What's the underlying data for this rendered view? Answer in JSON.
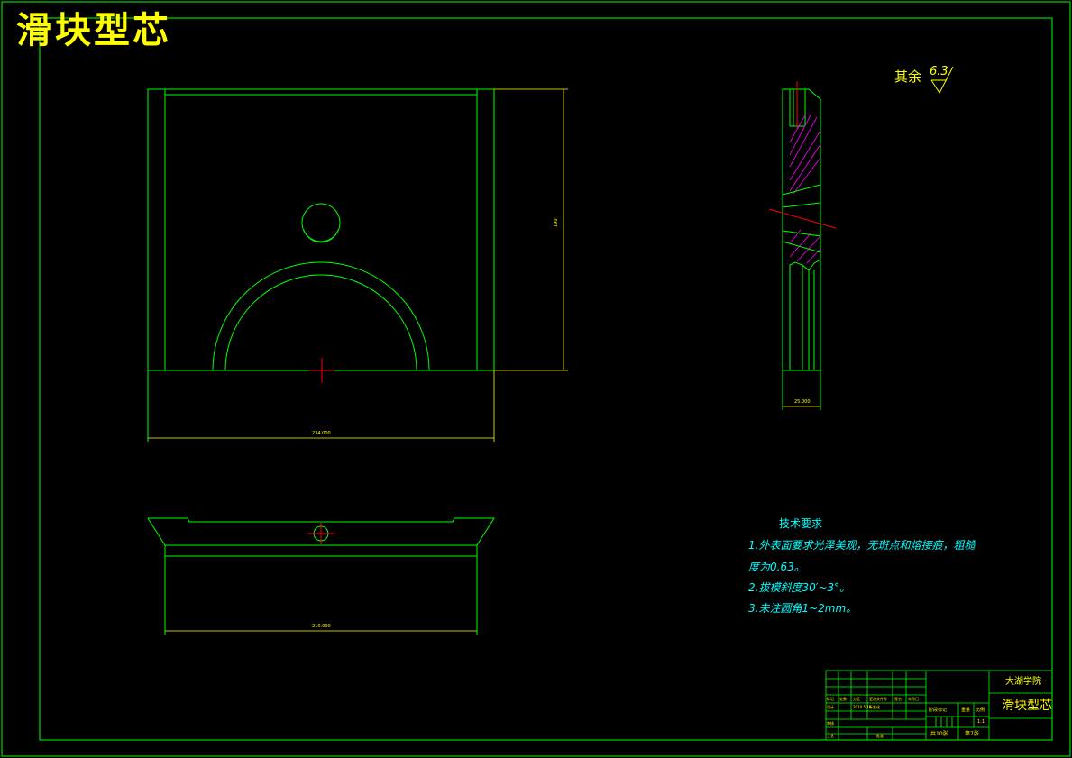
{
  "title": "滑块型芯",
  "roughness": {
    "label": "其余",
    "value": "6.3"
  },
  "tech_requirements": {
    "heading": "技术要求",
    "lines": [
      "1.外表面要求光泽美观，无斑点和熔接痕，粗糙",
      "度为0.63。",
      "2.拔模斜度30′~3°。",
      "3.未注圆角1~2mm。"
    ]
  },
  "dimensions": {
    "front_width": "234.000",
    "front_height": "190",
    "side_thickness": "25.000",
    "bottom_width": "210.000"
  },
  "title_block": {
    "school": "大湖学院",
    "part_name": "滑块型芯",
    "stage_mark": "阶段标记",
    "weight": "重量",
    "scale": "比例",
    "scale_value": "1:1",
    "sheets_total": "共10张",
    "sheet_no": "第7张",
    "marker": "标记",
    "count": "处数",
    "zone": "分区",
    "change_doc": "更改文件号",
    "signature": "签名",
    "date": "年月日",
    "designer": "设计",
    "design_date": "2010.5.10",
    "standardize": "标准化",
    "review": "审核",
    "process": "工艺",
    "approve": "批准"
  },
  "colors": {
    "outline": "#00ff00",
    "dimension": "#ffff00",
    "text_note": "#00ffff",
    "center_mark": "#ff0000",
    "hatch": "#ff00ff",
    "background": "#000000"
  }
}
